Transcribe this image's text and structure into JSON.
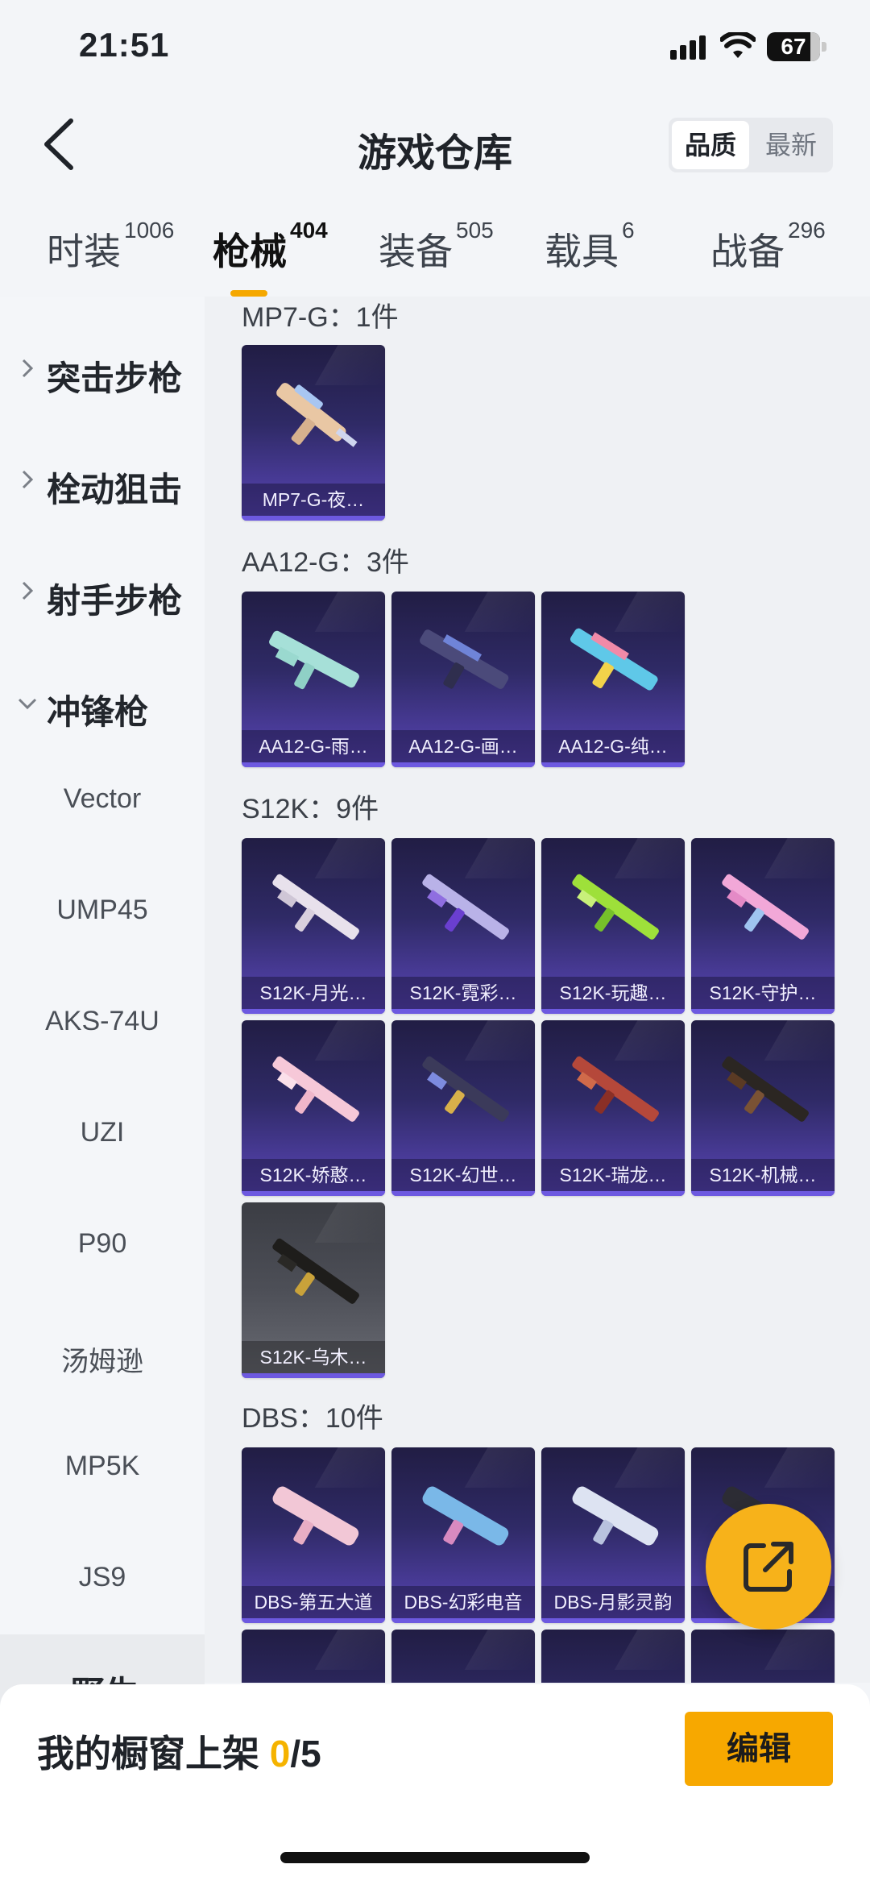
{
  "status_bar": {
    "time": "21:51",
    "battery": "67"
  },
  "header": {
    "title": "游戏仓库",
    "sort_options": [
      "品质",
      "最新"
    ]
  },
  "tabs": [
    {
      "label": "时装",
      "count": "1006"
    },
    {
      "label": "枪械",
      "count": "404"
    },
    {
      "label": "装备",
      "count": "505"
    },
    {
      "label": "载具",
      "count": "6"
    },
    {
      "label": "战备",
      "count": "296"
    }
  ],
  "sidebar": {
    "categories": [
      "突击步枪",
      "栓动狙击",
      "射手步枪",
      "冲锋枪"
    ],
    "subitems": [
      "Vector",
      "UMP45",
      "AKS-74U",
      "UZI",
      "P90",
      "汤姆逊",
      "MP5K",
      "JS9"
    ],
    "partial": "野生"
  },
  "groups": [
    {
      "title": "MP7-G：1件",
      "items": [
        "MP7-G-夜…"
      ]
    },
    {
      "title": "AA12-G：3件",
      "items": [
        "AA12-G-雨…",
        "AA12-G-画…",
        "AA12-G-纯…"
      ]
    },
    {
      "title": "S12K：9件",
      "items": [
        "S12K-月光…",
        "S12K-霓彩…",
        "S12K-玩趣…",
        "S12K-守护…",
        "S12K-娇憨…",
        "S12K-幻世…",
        "S12K-瑞龙…",
        "S12K-机械…",
        "S12K-乌木…"
      ]
    },
    {
      "title": "DBS：10件",
      "items": [
        "DBS-第五大道",
        "DBS-幻彩电音",
        "DBS-月影灵韵",
        "DBS-"
      ]
    }
  ],
  "bottom": {
    "label": "我的橱窗上架",
    "current": "0",
    "total": "/5",
    "edit_label": "编辑"
  },
  "colors": {
    "accent": "#f7a800",
    "card_purple": "#2f2a66",
    "card_grey": "#4d4f57"
  }
}
